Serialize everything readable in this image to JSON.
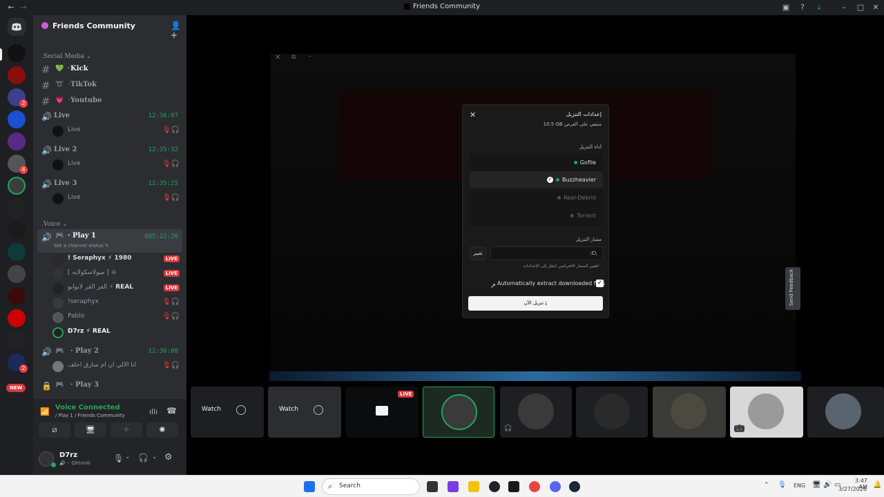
{
  "window": {
    "title": "Friends Community"
  },
  "server": {
    "name": "Friends Community"
  },
  "server_badges": [
    "2",
    "4",
    "2"
  ],
  "categories": {
    "social": "Social Media",
    "voice": "Voice"
  },
  "text_channels": [
    {
      "emoji": "💚",
      "name": "Kick"
    },
    {
      "emoji": "➰",
      "name": "TikTok"
    },
    {
      "emoji": "💗",
      "name": "Youtube"
    }
  ],
  "live_channels": [
    {
      "name": "Live",
      "time": "12:36:07",
      "member": "Live"
    },
    {
      "name": "Live 2",
      "time": "12:35:32",
      "member": "Live"
    },
    {
      "name": "Live 3",
      "time": "12:35:25",
      "member": "Live"
    }
  ],
  "play1": {
    "name": "Play 1",
    "time": "685:22:26",
    "status": "Set a channel status",
    "members": [
      {
        "name": "! Seraphyx",
        "tag": "1980",
        "live": "LIVE"
      },
      {
        "name": "[ ميولاسكولايه ]",
        "tag": "",
        "live": "LIVE"
      },
      {
        "name": "الفر الفر لابوابو",
        "tag": "REAL",
        "live": "LIVE"
      },
      {
        "name": "!seraphyx",
        "tag": "",
        "live": ""
      },
      {
        "name": "Pablo",
        "tag": "",
        "live": ""
      },
      {
        "name": "D7rz",
        "tag": "REAL",
        "live": ""
      }
    ]
  },
  "play2": {
    "name": "Play 2",
    "time": "12:36:00",
    "member": "انا الالي ان ام سارق احلف"
  },
  "play3": {
    "name": "Play 3"
  },
  "new_badge": "NEW",
  "voice": {
    "status": "Voice Connected",
    "location": "Play 1 / Friends Community"
  },
  "user": {
    "name": "D7rz",
    "sub": "Qhtoniii"
  },
  "modal": {
    "title": "إعدادات التنزيل",
    "space": "10.5 GB متبقي على القرص",
    "section_tool": "أداة التنزيل",
    "options": [
      {
        "label": "Gofile",
        "color": "#23a55a",
        "selected": false
      },
      {
        "label": "Buzzheavier",
        "color": "#23a55a",
        "selected": true
      },
      {
        "label": "Real-Debrid",
        "color": "#6d6f78",
        "selected": false
      },
      {
        "label": "Torrent",
        "color": "#6d6f78",
        "selected": false
      }
    ],
    "section_path": "مسار التنزيل",
    "change_btn": "تغيير",
    "path_value": ":C\\",
    "path_hint": "لتغيير المسار الافتراضي انتقل إلى الإعدادات",
    "extract_label": "Automatically extract downloaded files",
    "download_btn": "تنزيل الآن"
  },
  "filmstrip": {
    "watch": "Watch",
    "live": "LIVE"
  },
  "feedback": "Send Feedback",
  "taskbar": {
    "search": "Search",
    "lang": "ENG",
    "time": "3:47 AM",
    "date": "3/27/2026"
  }
}
